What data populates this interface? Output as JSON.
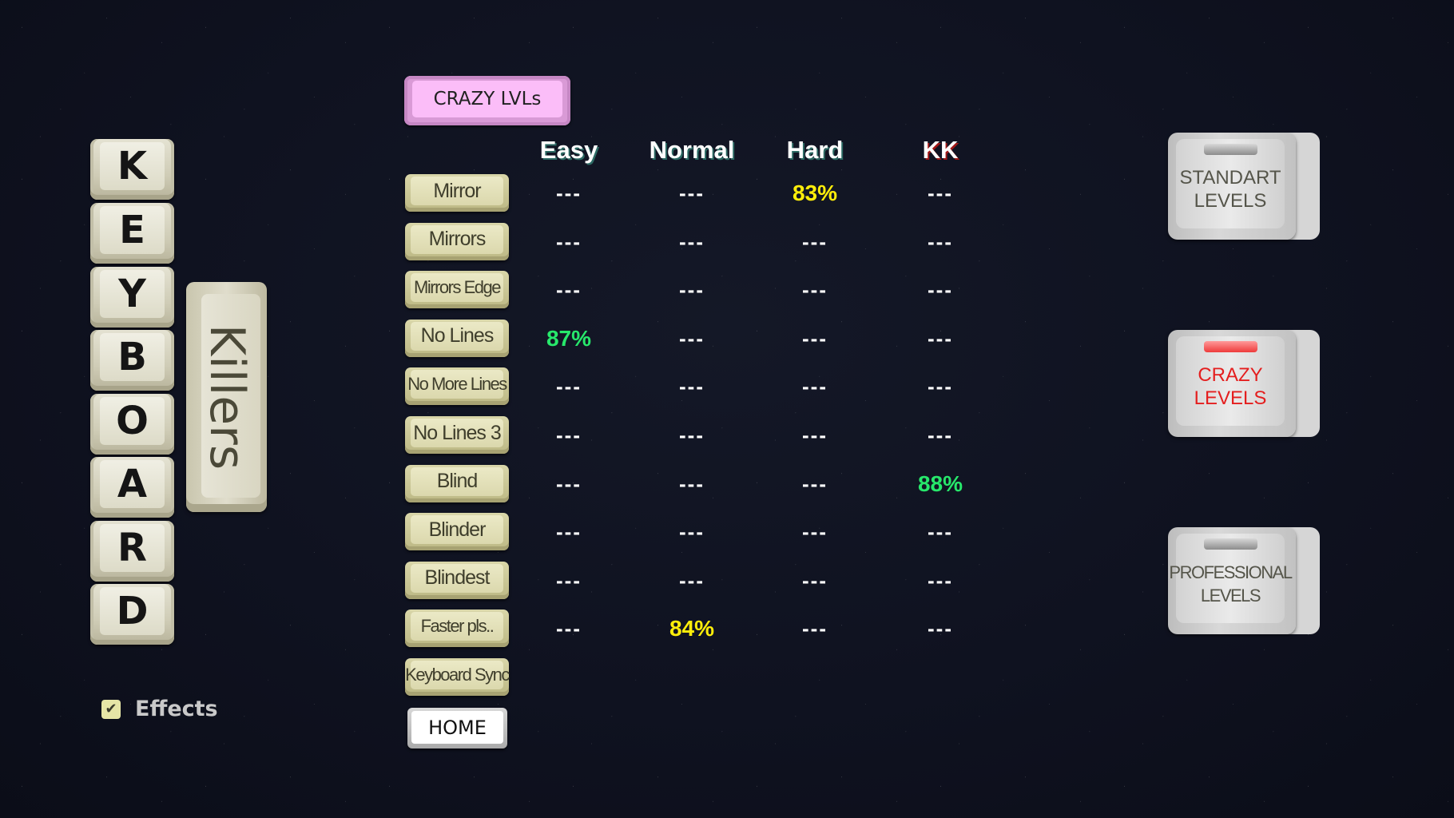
{
  "title_keys": [
    "K",
    "E",
    "Y",
    "B",
    "O",
    "A",
    "R",
    "D"
  ],
  "subtitle_key": "Killers",
  "header": {
    "category_label": "CRAZY LVLs"
  },
  "columns": [
    {
      "label": "Easy"
    },
    {
      "label": "Normal"
    },
    {
      "label": "Hard"
    },
    {
      "label": "KK"
    }
  ],
  "levels": [
    {
      "name": "Mirror",
      "scores": [
        "---",
        "---",
        "83%",
        "---"
      ]
    },
    {
      "name": "Mirrors",
      "scores": [
        "---",
        "---",
        "---",
        "---"
      ]
    },
    {
      "name": "Mirrors Edge",
      "scores": [
        "---",
        "---",
        "---",
        "---"
      ]
    },
    {
      "name": "No Lines",
      "scores": [
        "87%",
        "---",
        "---",
        "---"
      ]
    },
    {
      "name": "No More Lines",
      "scores": [
        "---",
        "---",
        "---",
        "---"
      ]
    },
    {
      "name": "No Lines 3",
      "scores": [
        "---",
        "---",
        "---",
        "---"
      ]
    },
    {
      "name": "Blind",
      "scores": [
        "---",
        "---",
        "---",
        "88%"
      ]
    },
    {
      "name": "Blinder",
      "scores": [
        "---",
        "---",
        "---",
        "---"
      ]
    },
    {
      "name": "Blindest",
      "scores": [
        "---",
        "---",
        "---",
        "---"
      ]
    },
    {
      "name": "Faster pls..",
      "scores": [
        "---",
        "84%",
        "---",
        "---"
      ]
    },
    {
      "name": "Keyboard Sync",
      "scores": []
    }
  ],
  "score_colors": {
    "high": "#27e86b",
    "mid": "#ffee0a",
    "none": "#ffffff"
  },
  "home_label": "HOME",
  "effects": {
    "label": "Effects",
    "checked": true,
    "icon": "checkmark-icon"
  },
  "mode_buttons": [
    {
      "line1": "STANDART",
      "line2": "LEVELS",
      "active": false
    },
    {
      "line1": "CRAZY",
      "line2": "LEVELS",
      "active": true
    },
    {
      "line1": "PROFESSIONAL",
      "line2": "LEVELS",
      "active": false
    }
  ]
}
